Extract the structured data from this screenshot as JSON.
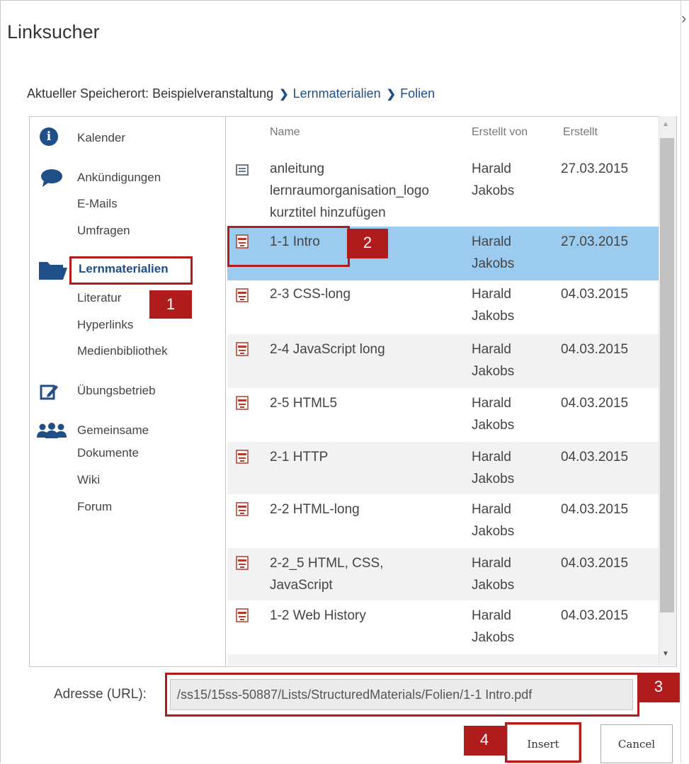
{
  "dialog": {
    "title": "Linksucher",
    "close_glyph": "›"
  },
  "breadcrumb": {
    "prefix": "Aktueller Speicherort: Beispielveranstaltung",
    "separator": "❯",
    "items": [
      "Lernmaterialien",
      "Folien"
    ]
  },
  "sidebar": {
    "items": [
      {
        "label": "Kalender",
        "icon": "info-icon"
      },
      {
        "label": "Ankündigungen",
        "icon": "chat-icon"
      },
      {
        "label": "E-Mails"
      },
      {
        "label": "Umfragen"
      },
      {
        "label": "Lernmaterialien",
        "icon": "folder-icon",
        "active": true
      },
      {
        "label": "Literatur"
      },
      {
        "label": "Hyperlinks"
      },
      {
        "label": "Medienbibliothek"
      },
      {
        "label": "Übungsbetrieb",
        "icon": "edit-icon"
      },
      {
        "label": "Gemeinsame",
        "icon": "group-icon"
      },
      {
        "label": "Dokumente"
      },
      {
        "label": "Wiki"
      },
      {
        "label": "Forum"
      }
    ]
  },
  "file_list": {
    "columns": [
      "Name",
      "Erstellt von",
      "Erstellt"
    ],
    "rows": [
      {
        "name": "anleitung lernraumorganisation_logo kurztitel hinzufügen",
        "author": "Harald Jakobs",
        "date": "27.03.2015",
        "icon": "image-icon"
      },
      {
        "name": "1-1 Intro",
        "author": "Harald Jakobs",
        "date": "27.03.2015",
        "icon": "pdf-icon",
        "selected": true
      },
      {
        "name": "2-3 CSS-long",
        "author": "Harald Jakobs",
        "date": "04.03.2015",
        "icon": "pdf-icon"
      },
      {
        "name": "2-4 JavaScript long",
        "author": "Harald Jakobs",
        "date": "04.03.2015",
        "icon": "pdf-icon"
      },
      {
        "name": "2-5 HTML5",
        "author": "Harald Jakobs",
        "date": "04.03.2015",
        "icon": "pdf-icon"
      },
      {
        "name": "2-1 HTTP",
        "author": "Harald Jakobs",
        "date": "04.03.2015",
        "icon": "pdf-icon"
      },
      {
        "name": "2-2 HTML-long",
        "author": "Harald Jakobs",
        "date": "04.03.2015",
        "icon": "pdf-icon"
      },
      {
        "name": "2-2_5 HTML, CSS, JavaScript",
        "author": "Harald Jakobs",
        "date": "04.03.2015",
        "icon": "pdf-icon"
      },
      {
        "name": "1-2 Web History",
        "author": "Harald Jakobs",
        "date": "04.03.2015",
        "icon": "pdf-icon"
      }
    ]
  },
  "url_field": {
    "label": "Adresse (URL):",
    "value": "/ss15/15ss-50887/Lists/StructuredMaterials/Folien/1-1 Intro.pdf"
  },
  "buttons": {
    "insert": "Insert",
    "cancel": "Cancel"
  },
  "callouts": [
    "1",
    "2",
    "3",
    "4"
  ],
  "colors": {
    "accent": "#1f4f86",
    "selected_row": "#9ccbf0",
    "callout": "#b01b1b"
  }
}
